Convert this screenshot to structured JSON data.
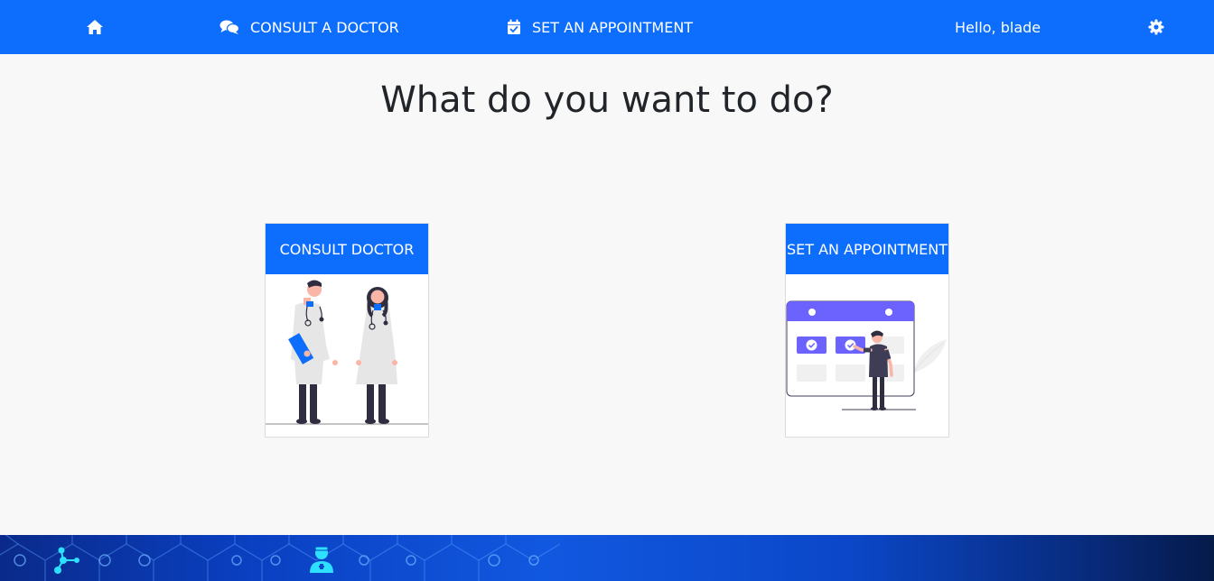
{
  "navbar": {
    "home_icon": "home-icon",
    "consult": {
      "icon": "chat-bubbles-icon",
      "label": "CONSULT A DOCTOR"
    },
    "appointment": {
      "icon": "calendar-check-icon",
      "label": "SET AN APPOINTMENT"
    },
    "greeting": "Hello, blade",
    "settings_icon": "gear-icon"
  },
  "main": {
    "title": "What do you want to do?",
    "cards": [
      {
        "label": "CONSULT DOCTOR",
        "illustration": "doctors-illustration"
      },
      {
        "label": "SET AN APPOINTMENT",
        "illustration": "calendar-illustration"
      }
    ]
  },
  "footer": {
    "icon": "doctor-icon",
    "pattern": "hexagon-network-pattern"
  },
  "colors": {
    "primary": "#0d6efd",
    "background": "#f8f8f8",
    "accent_purple": "#6c63ff",
    "text": "#212529"
  }
}
